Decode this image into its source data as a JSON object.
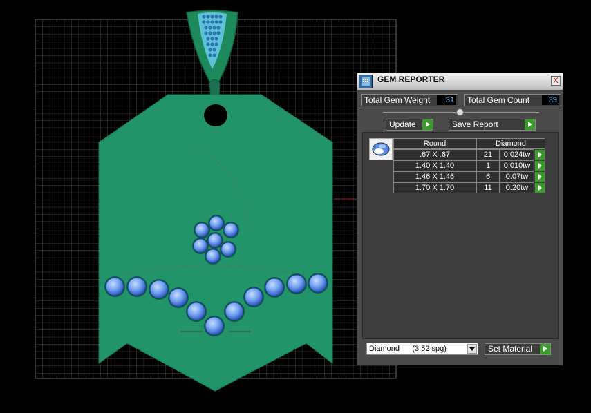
{
  "gem_reporter": {
    "title": "GEM REPORTER",
    "close_label": "X",
    "total_weight_label": "Total Gem Weight",
    "total_weight_value": ".31",
    "total_count_label": "Total Gem Count",
    "total_count_value": "39",
    "update_label": "Update",
    "save_report_label": "Save Report",
    "table": {
      "headers": [
        "Round",
        "Diamond"
      ],
      "rows": [
        {
          "size": ".67 X .67",
          "count": "21",
          "weight": "0.024tw"
        },
        {
          "size": "1.40 X 1.40",
          "count": "1",
          "weight": "0.010tw"
        },
        {
          "size": "1.46 X 1.46",
          "count": "6",
          "weight": "0.07tw"
        },
        {
          "size": "1.70 X 1.70",
          "count": "11",
          "weight": "0.20tw"
        }
      ]
    },
    "material_select": "Diamond      (3.52 spg)",
    "set_material_label": "Set Material"
  },
  "colors": {
    "pendant": "#229469",
    "gem": "#3f6fce",
    "grid": "#5a5a5a",
    "arrow": "#3a9a2a"
  }
}
